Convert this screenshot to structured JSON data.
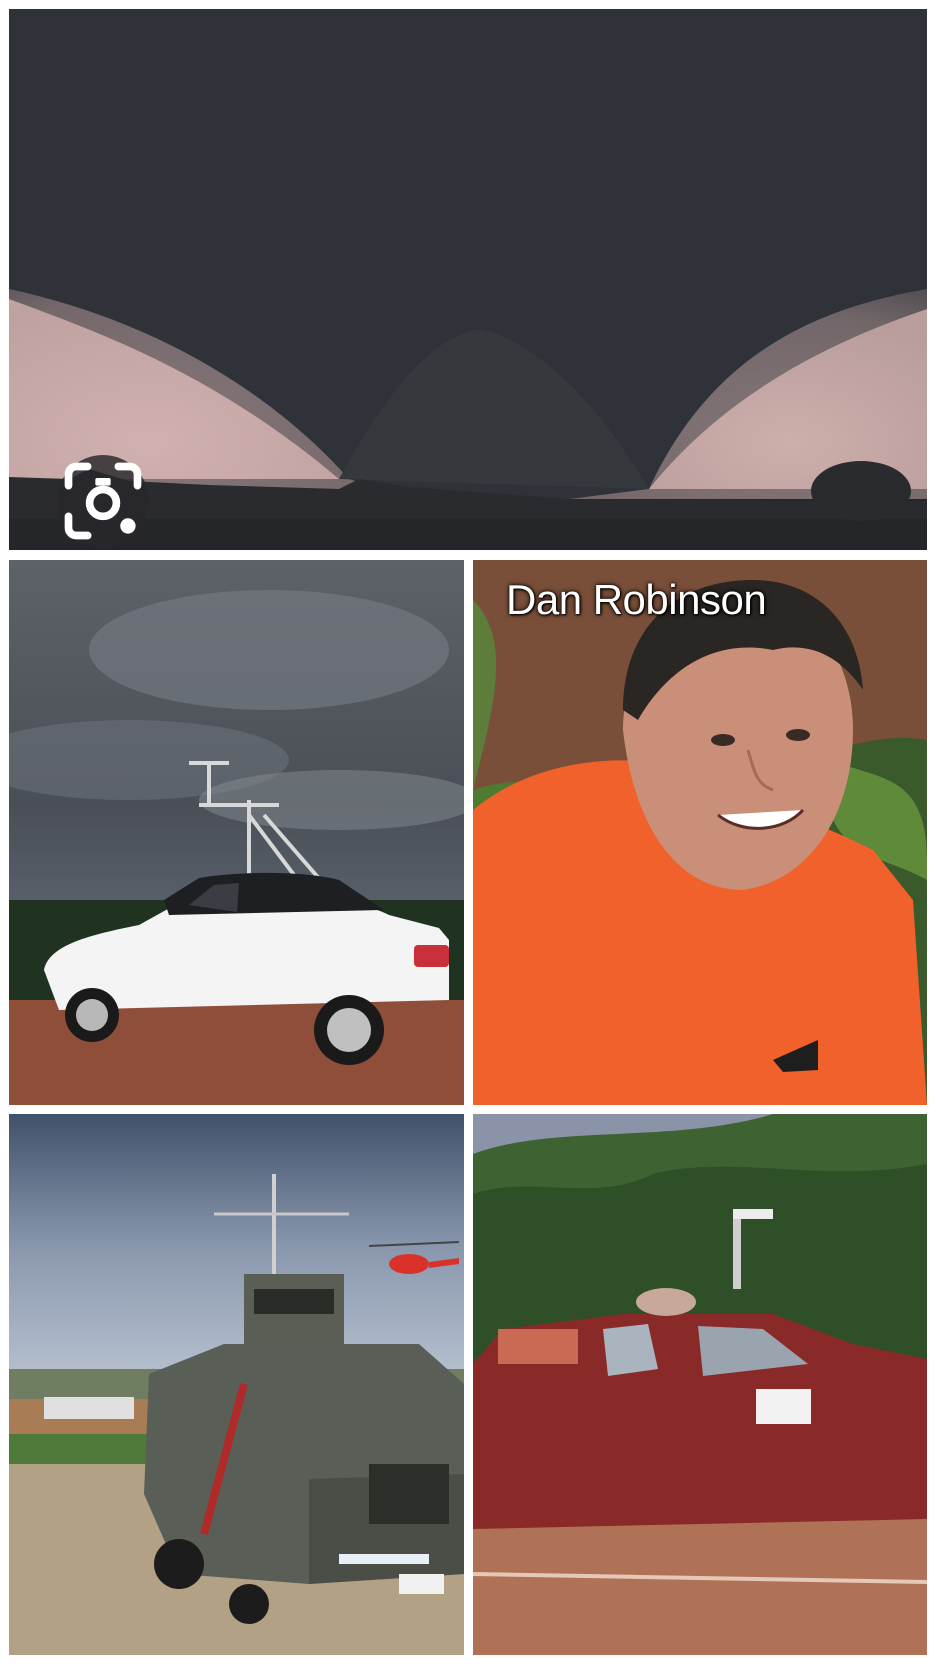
{
  "gallery": {
    "photo_1": {
      "subject": "tornado"
    },
    "photo_2": {
      "subject": "white-sedan-with-instruments"
    },
    "photo_3": {
      "subject": "smiling-man-orange-shirt",
      "caption": "Dan Robinson"
    },
    "photo_4": {
      "subject": "armored-tornado-intercept-vehicle"
    },
    "photo_5": {
      "subject": "red-armored-car"
    }
  },
  "lens_button": {
    "icon": "google-lens-icon"
  },
  "colors": {
    "background": "#ffffff",
    "lens_bg": "#28282c"
  }
}
